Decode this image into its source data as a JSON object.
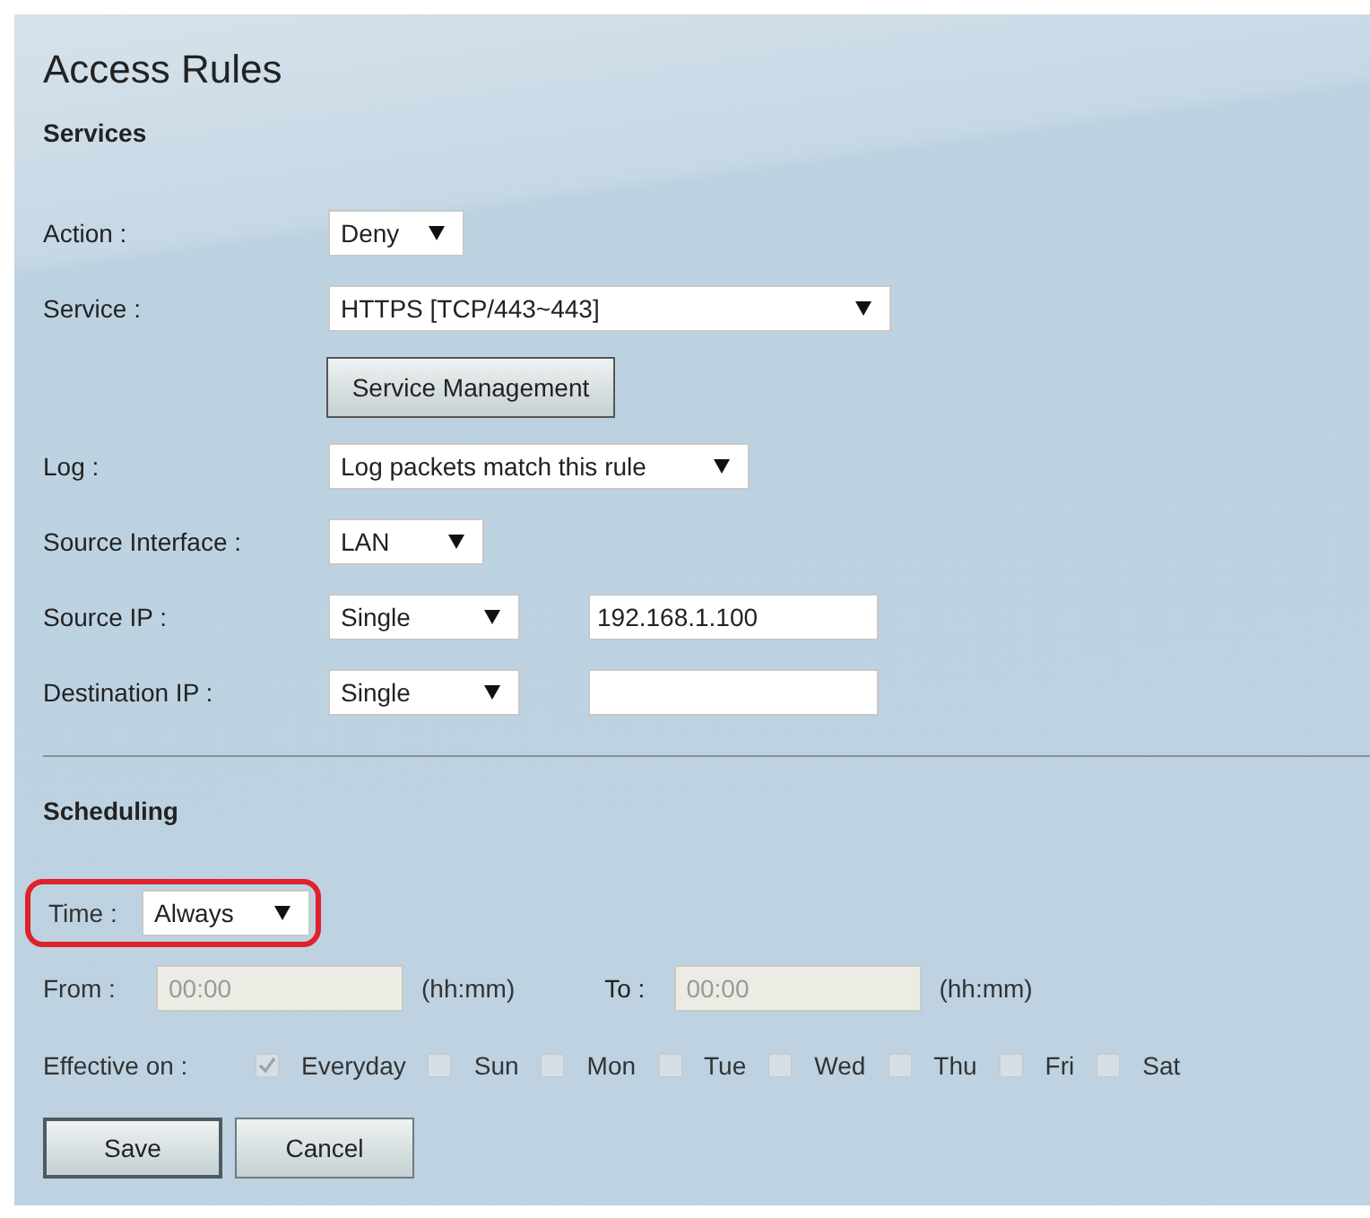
{
  "title": "Access Rules",
  "services": {
    "heading": "Services",
    "fields": [
      {
        "kind": "select",
        "label": "Action :",
        "value": "Deny"
      },
      {
        "kind": "select",
        "label": "Service :",
        "value": "HTTPS [TCP/443~443]"
      },
      {
        "kind": "button",
        "label": "Service Management"
      },
      {
        "kind": "select",
        "label": "Log :",
        "value": "Log packets match this rule"
      },
      {
        "kind": "select",
        "label": "Source Interface :",
        "value": "LAN"
      },
      {
        "kind": "select_input",
        "label": "Source IP :",
        "value": "Single",
        "input": "192.168.1.100"
      },
      {
        "kind": "select_input",
        "label": "Destination IP :",
        "value": "Single"
      }
    ]
  },
  "scheduling": {
    "heading": "Scheduling",
    "time": {
      "label": "Time :",
      "value": "Always",
      "highlighted": true
    },
    "from": {
      "label": "From :",
      "value": "00:00",
      "disabled": true,
      "unit": "(hh:mm)"
    },
    "to": {
      "label": "To :",
      "value": "00:00",
      "disabled": true,
      "unit": "(hh:mm)"
    },
    "effective": {
      "label": "Effective on :",
      "days": [
        {
          "label": "Everyday",
          "checked": true,
          "disabled": true
        },
        {
          "label": "Sun",
          "checked": false,
          "disabled": true
        },
        {
          "label": "Mon",
          "checked": false,
          "disabled": true
        },
        {
          "label": "Tue",
          "checked": false,
          "disabled": true
        },
        {
          "label": "Wed",
          "checked": false,
          "disabled": true
        },
        {
          "label": "Thu",
          "checked": false,
          "disabled": true
        },
        {
          "label": "Fri",
          "checked": false,
          "disabled": true
        },
        {
          "label": "Sat",
          "checked": false,
          "disabled": true
        }
      ]
    }
  },
  "buttons": [
    {
      "label": "Save",
      "default": true
    },
    {
      "label": "Cancel",
      "default": false
    }
  ]
}
